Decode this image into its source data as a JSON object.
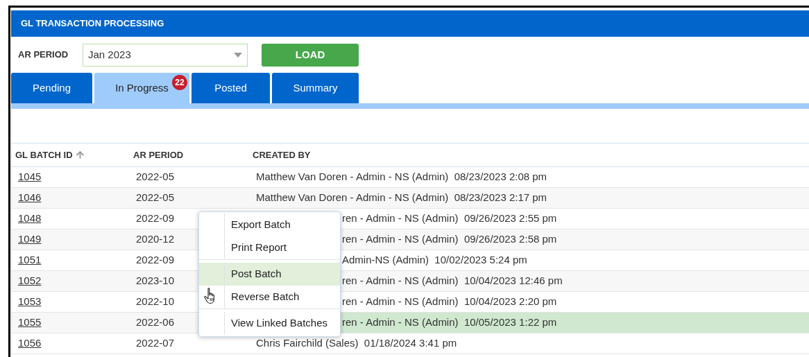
{
  "window": {
    "title": "GL TRANSACTION PROCESSING"
  },
  "filter": {
    "label": "AR PERIOD",
    "value": "Jan 2023",
    "button": "LOAD"
  },
  "tabs": [
    {
      "label": "Pending",
      "selected": false
    },
    {
      "label": "In Progress",
      "selected": true,
      "badge": "22"
    },
    {
      "label": "Posted",
      "selected": false
    },
    {
      "label": "Summary",
      "selected": false
    }
  ],
  "table": {
    "columns": [
      {
        "label": "GL BATCH ID",
        "sorted": true
      },
      {
        "label": "AR PERIOD"
      },
      {
        "label": "CREATED BY"
      }
    ],
    "rows": [
      {
        "id": "1045",
        "period": "2022-05",
        "created_by": "Matthew Van Doren - Admin - NS (Admin)  08/23/2023 2:08 pm",
        "selected": false
      },
      {
        "id": "1046",
        "period": "2022-05",
        "created_by": "Matthew Van Doren - Admin - NS (Admin)  08/23/2023 2:17 pm",
        "selected": false
      },
      {
        "id": "1048",
        "period": "2022-09",
        "created_by": "ren - Admin - NS (Admin)  09/26/2023 2:55 pm",
        "partly_hidden": true,
        "selected": false
      },
      {
        "id": "1049",
        "period": "2020-12",
        "created_by": "ren - Admin - NS (Admin)  09/26/2023 2:58 pm",
        "partly_hidden": true,
        "selected": false
      },
      {
        "id": "1051",
        "period": "2022-09",
        "created_by": "Admin-NS (Admin)  10/02/2023 5:24 pm",
        "partly_hidden": true,
        "selected": false
      },
      {
        "id": "1052",
        "period": "2023-10",
        "created_by": "ren - Admin - NS (Admin)  10/04/2023 12:46 pm",
        "partly_hidden": true,
        "selected": false
      },
      {
        "id": "1053",
        "period": "2022-10",
        "created_by": "ren - Admin - NS (Admin)  10/04/2023 2:20 pm",
        "partly_hidden": true,
        "selected": false
      },
      {
        "id": "1055",
        "period": "2022-06",
        "created_by": "ren - Admin - NS (Admin)  10/05/2023 1:22 pm",
        "partly_hidden": true,
        "selected": true
      },
      {
        "id": "1056",
        "period": "2022-07",
        "created_by": "Chris Fairchild (Sales)  01/18/2024 3:41 pm",
        "selected": false
      }
    ]
  },
  "context_menu": {
    "groups": [
      [
        {
          "label": "Export Batch",
          "selected": false
        },
        {
          "label": "Print Report",
          "selected": false
        }
      ],
      [
        {
          "label": "Post Batch",
          "selected": true
        },
        {
          "label": "Reverse Batch",
          "selected": false
        }
      ],
      [
        {
          "label": "View Linked Batches",
          "selected": false
        }
      ]
    ]
  }
}
